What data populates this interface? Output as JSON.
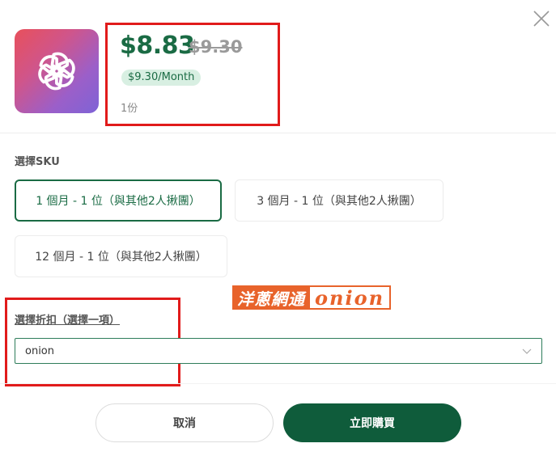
{
  "product": {
    "logo": "openai-logo-icon",
    "price_now": "$8.83",
    "price_old": "$9.30",
    "price_month": "$9.30/Month",
    "quantity": "1份"
  },
  "sku": {
    "label": "選擇SKU",
    "options": [
      {
        "label": "1 個月 - 1 位（與其他2人揪團）",
        "selected": true
      },
      {
        "label": "3 個月 - 1 位（與其他2人揪團）",
        "selected": false
      },
      {
        "label": "12 個月 - 1 位（與其他2人揪團）",
        "selected": false
      }
    ]
  },
  "watermark": {
    "cn": "洋蔥網通",
    "en": "onion"
  },
  "discount": {
    "label": "選擇折扣（選擇一項）",
    "value": "onion"
  },
  "actions": {
    "cancel": "取消",
    "buy": "立即購買"
  },
  "colors": {
    "accent": "#1a6b44",
    "buy_button": "#0f5c3b",
    "highlight": "#e11b1b",
    "watermark": "#e8632b"
  }
}
